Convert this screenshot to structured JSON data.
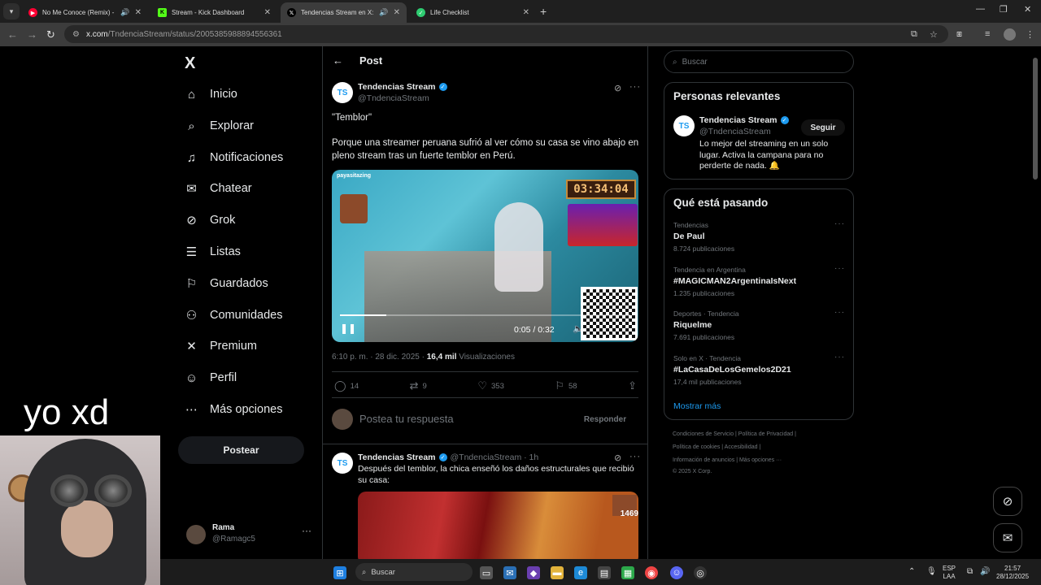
{
  "browser": {
    "tabs": [
      {
        "title": "No Me Conoce (Remix) - Yo",
        "favicon": "youtube-music-icon",
        "color": "#ff0033",
        "active": false
      },
      {
        "title": "Stream - Kick Dashboard",
        "favicon": "kick-icon",
        "color": "#53fc18",
        "active": false
      },
      {
        "title": "Tendencias Stream en X: \"\"T",
        "favicon": "x-icon",
        "color": "#000000",
        "active": true
      },
      {
        "title": "Life Checklist",
        "favicon": "checklist-icon",
        "color": "#2ecc71",
        "active": false
      }
    ],
    "url_host": "x.com",
    "url_path": "/TndenciaStream/status/2005385988894556361"
  },
  "sidebar": {
    "logo": "X",
    "items": [
      {
        "label": "Inicio",
        "icon": "home-icon"
      },
      {
        "label": "Explorar",
        "icon": "search-icon"
      },
      {
        "label": "Notificaciones",
        "icon": "bell-icon"
      },
      {
        "label": "Chatear",
        "icon": "mail-icon"
      },
      {
        "label": "Grok",
        "icon": "grok-icon"
      },
      {
        "label": "Listas",
        "icon": "list-icon"
      },
      {
        "label": "Guardados",
        "icon": "bookmark-icon"
      },
      {
        "label": "Comunidades",
        "icon": "people-icon"
      },
      {
        "label": "Premium",
        "icon": "x-icon"
      },
      {
        "label": "Perfil",
        "icon": "user-icon"
      },
      {
        "label": "Más opciones",
        "icon": "more-circle-icon"
      }
    ],
    "post_button": "Postear",
    "account": {
      "name": "Rama",
      "handle": "@Ramagc5"
    }
  },
  "main": {
    "header": "Post",
    "tweet": {
      "name": "Tendencias Stream",
      "handle": "@TndenciaStream",
      "quote": "\"Temblor\"",
      "body": "Porque una streamer peruana sufrió al ver cómo su casa se vino abajo en pleno stream tras un fuerte temblor en Perú.",
      "video": {
        "tag": "payasitazing",
        "timer": "03:34:04",
        "time": "0:05 / 0:32",
        "progress": 0.16
      },
      "time": "6:10 p. m. · 28 dic. 2025 · ",
      "views": "16,4 mil",
      "views_label": " Visualizaciones",
      "replies": "14",
      "retweets": "9",
      "likes": "353",
      "bookmarks": "58"
    },
    "reply_placeholder": "Postea tu respuesta",
    "reply_button": "Responder",
    "reply_tweet": {
      "name": "Tendencias Stream",
      "handle": "@TndenciaStream · 1h",
      "body": "Después del temblor, la chica enseñó los daños estructurales que recibió su casa:",
      "thumb_number": "1469"
    }
  },
  "right": {
    "search_placeholder": "Buscar",
    "relevant": {
      "title": "Personas relevantes",
      "name": "Tendencias Stream",
      "handle": "@TndenciaStream",
      "follow": "Seguir",
      "bio": "Lo mejor del streaming en un solo lugar. Activa la campana para no perderte de nada. 🔔"
    },
    "trending": {
      "title": "Qué está pasando",
      "items": [
        {
          "context": "Tendencias",
          "title": "De Paul",
          "count": "8.724 publicaciones"
        },
        {
          "context": "Tendencia en Argentina",
          "title": "#MAGICMAN2ArgentinaIsNext",
          "count": "1.235 publicaciones"
        },
        {
          "context": "Deportes · Tendencia",
          "title": "Riquelme",
          "count": "7.691 publicaciones"
        },
        {
          "context": "Solo en X · Tendencia",
          "title": "#LaCasaDeLosGemelos2D21",
          "count": "17,4 mil publicaciones"
        }
      ],
      "show_more": "Mostrar más"
    },
    "footer": {
      "line1": "Condiciones de Servicio  |   Política de Privacidad  |",
      "line2": "Política de cookies  |   Accesibilidad  |",
      "line3": "Información de anuncios  |   Más opciones ···",
      "line4": "© 2025 X Corp."
    }
  },
  "overlay": {
    "text": "yo xd"
  },
  "taskbar": {
    "search": "Buscar",
    "lang": "ESP",
    "lang2": "LAA",
    "time": "21:57",
    "date": "28/12/2025"
  }
}
